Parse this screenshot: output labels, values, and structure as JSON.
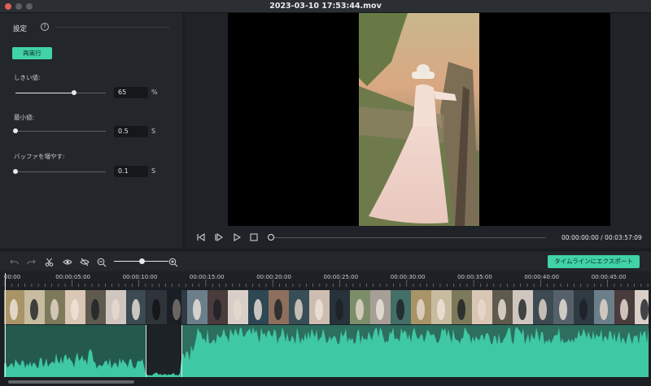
{
  "window": {
    "title": "2023-03-10 17:53:44.mov"
  },
  "settings": {
    "title": "設定",
    "help": "?",
    "rerun_label": "再実行",
    "threshold": {
      "label": "しきい値:",
      "value": "65",
      "unit": "%",
      "level": 0.65
    },
    "minimum": {
      "label": "最小値:",
      "value": "0.5",
      "unit": "S",
      "level": 0.0
    },
    "buffer": {
      "label": "バッファを増やす:",
      "value": "0.1",
      "unit": "S",
      "level": 0.0
    }
  },
  "player": {
    "timecode": "00:00:00:00 / 00:03:57:09",
    "progress": 0.0
  },
  "toolbar": {
    "export_label": "タイムラインにエクスポート",
    "zoom_level": 0.5,
    "icons": [
      "undo-icon",
      "redo-icon",
      "scissors-icon",
      "eye-icon",
      "eye-off-icon",
      "zoom-out-icon",
      "zoom-in-icon"
    ]
  },
  "ruler": {
    "labels": [
      "00:00",
      "00:00:05:00",
      "00:00:10:00",
      "00:00:15:00",
      "00:00:20:00",
      "00:00:25:00",
      "00:00:30:00",
      "00:00:35:00",
      "00:00:40:00",
      "00:00:45:00"
    ]
  },
  "colors": {
    "accent": "#40d2a8",
    "waveform": "#3ec8a3",
    "background": "#1b1e22"
  }
}
